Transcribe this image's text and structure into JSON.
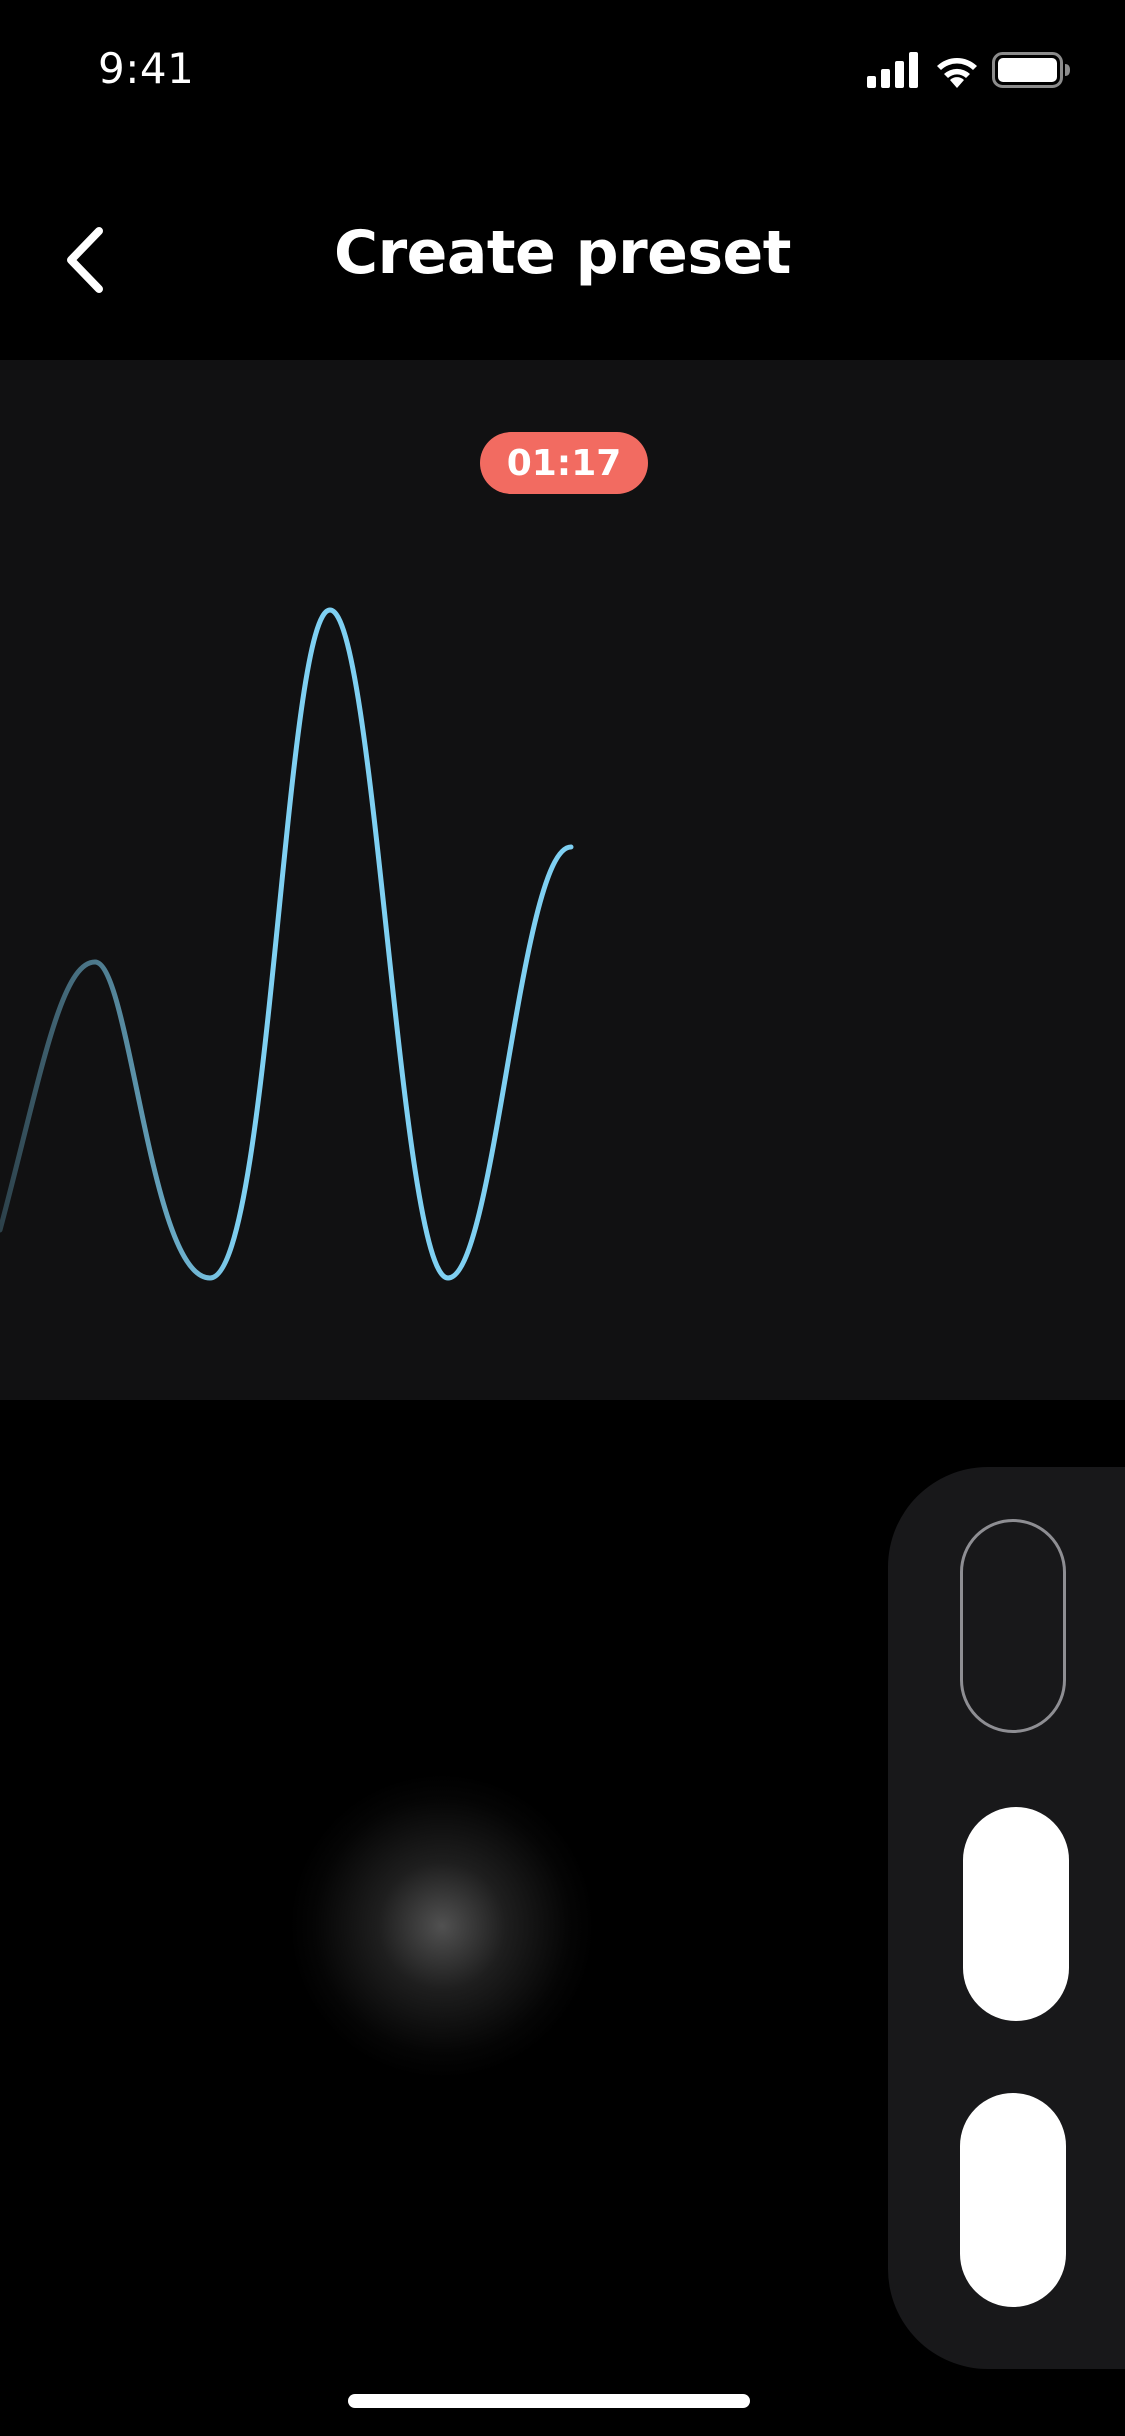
{
  "status_bar": {
    "time": "9:41",
    "icons": [
      "cellular-signal-icon",
      "wifi-icon",
      "battery-icon"
    ]
  },
  "nav": {
    "back_icon": "chevron-left-icon",
    "title": "Create preset"
  },
  "recorder": {
    "timer": "01:17",
    "timer_color": "#f26b61",
    "wave_color": "#7fd0f2"
  },
  "controls": {
    "toggles": [
      {
        "state": "off"
      },
      {
        "state": "on"
      },
      {
        "state": "on"
      }
    ]
  }
}
